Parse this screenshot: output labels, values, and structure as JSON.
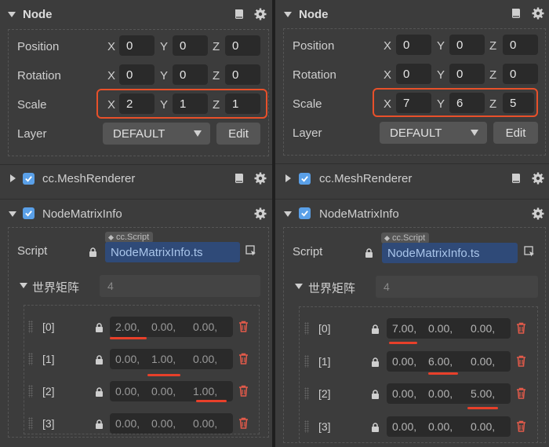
{
  "colors": {
    "accent": "#5aa0e8",
    "highlight": "#e8502a",
    "panel": "#3c3c3c",
    "field": "#2a2a2a"
  },
  "panels": [
    {
      "node": {
        "title": "Node",
        "position": {
          "label": "Position",
          "x": "0",
          "y": "0",
          "z": "0"
        },
        "rotation": {
          "label": "Rotation",
          "x": "0",
          "y": "0",
          "z": "0"
        },
        "scale": {
          "label": "Scale",
          "x": "2",
          "y": "1",
          "z": "1"
        },
        "layer": {
          "label": "Layer",
          "value": "DEFAULT",
          "edit": "Edit"
        }
      },
      "mesh_renderer": {
        "title": "cc.MeshRenderer"
      },
      "matrix_info": {
        "title": "NodeMatrixInfo",
        "script_label": "Script",
        "script_tag": "cc.Script",
        "script_value": "NodeMatrixInfo.ts",
        "world_matrix_label": "世界矩阵",
        "world_matrix_count": "4",
        "rows": [
          {
            "index": "[0]",
            "c0": "2.00,",
            "c1": "0.00,",
            "c2": "0.00,"
          },
          {
            "index": "[1]",
            "c0": "0.00,",
            "c1": "1.00,",
            "c2": "0.00,"
          },
          {
            "index": "[2]",
            "c0": "0.00,",
            "c1": "0.00,",
            "c2": "1.00,"
          },
          {
            "index": "[3]",
            "c0": "0.00,",
            "c1": "0.00,",
            "c2": "0.00,"
          }
        ]
      }
    },
    {
      "node": {
        "title": "Node",
        "position": {
          "label": "Position",
          "x": "0",
          "y": "0",
          "z": "0"
        },
        "rotation": {
          "label": "Rotation",
          "x": "0",
          "y": "0",
          "z": "0"
        },
        "scale": {
          "label": "Scale",
          "x": "7",
          "y": "6",
          "z": "5"
        },
        "layer": {
          "label": "Layer",
          "value": "DEFAULT",
          "edit": "Edit"
        }
      },
      "mesh_renderer": {
        "title": "cc.MeshRenderer"
      },
      "matrix_info": {
        "title": "NodeMatrixInfo",
        "script_label": "Script",
        "script_tag": "cc.Script",
        "script_value": "NodeMatrixInfo.ts",
        "world_matrix_label": "世界矩阵",
        "world_matrix_count": "4",
        "rows": [
          {
            "index": "[0]",
            "c0": "7.00,",
            "c1": "0.00,",
            "c2": "0.00,"
          },
          {
            "index": "[1]",
            "c0": "0.00,",
            "c1": "6.00,",
            "c2": "0.00,"
          },
          {
            "index": "[2]",
            "c0": "0.00,",
            "c1": "0.00,",
            "c2": "5.00,"
          },
          {
            "index": "[3]",
            "c0": "0.00,",
            "c1": "0.00,",
            "c2": "0.00,"
          }
        ]
      }
    }
  ],
  "axis_labels": {
    "x": "X",
    "y": "Y",
    "z": "Z"
  }
}
